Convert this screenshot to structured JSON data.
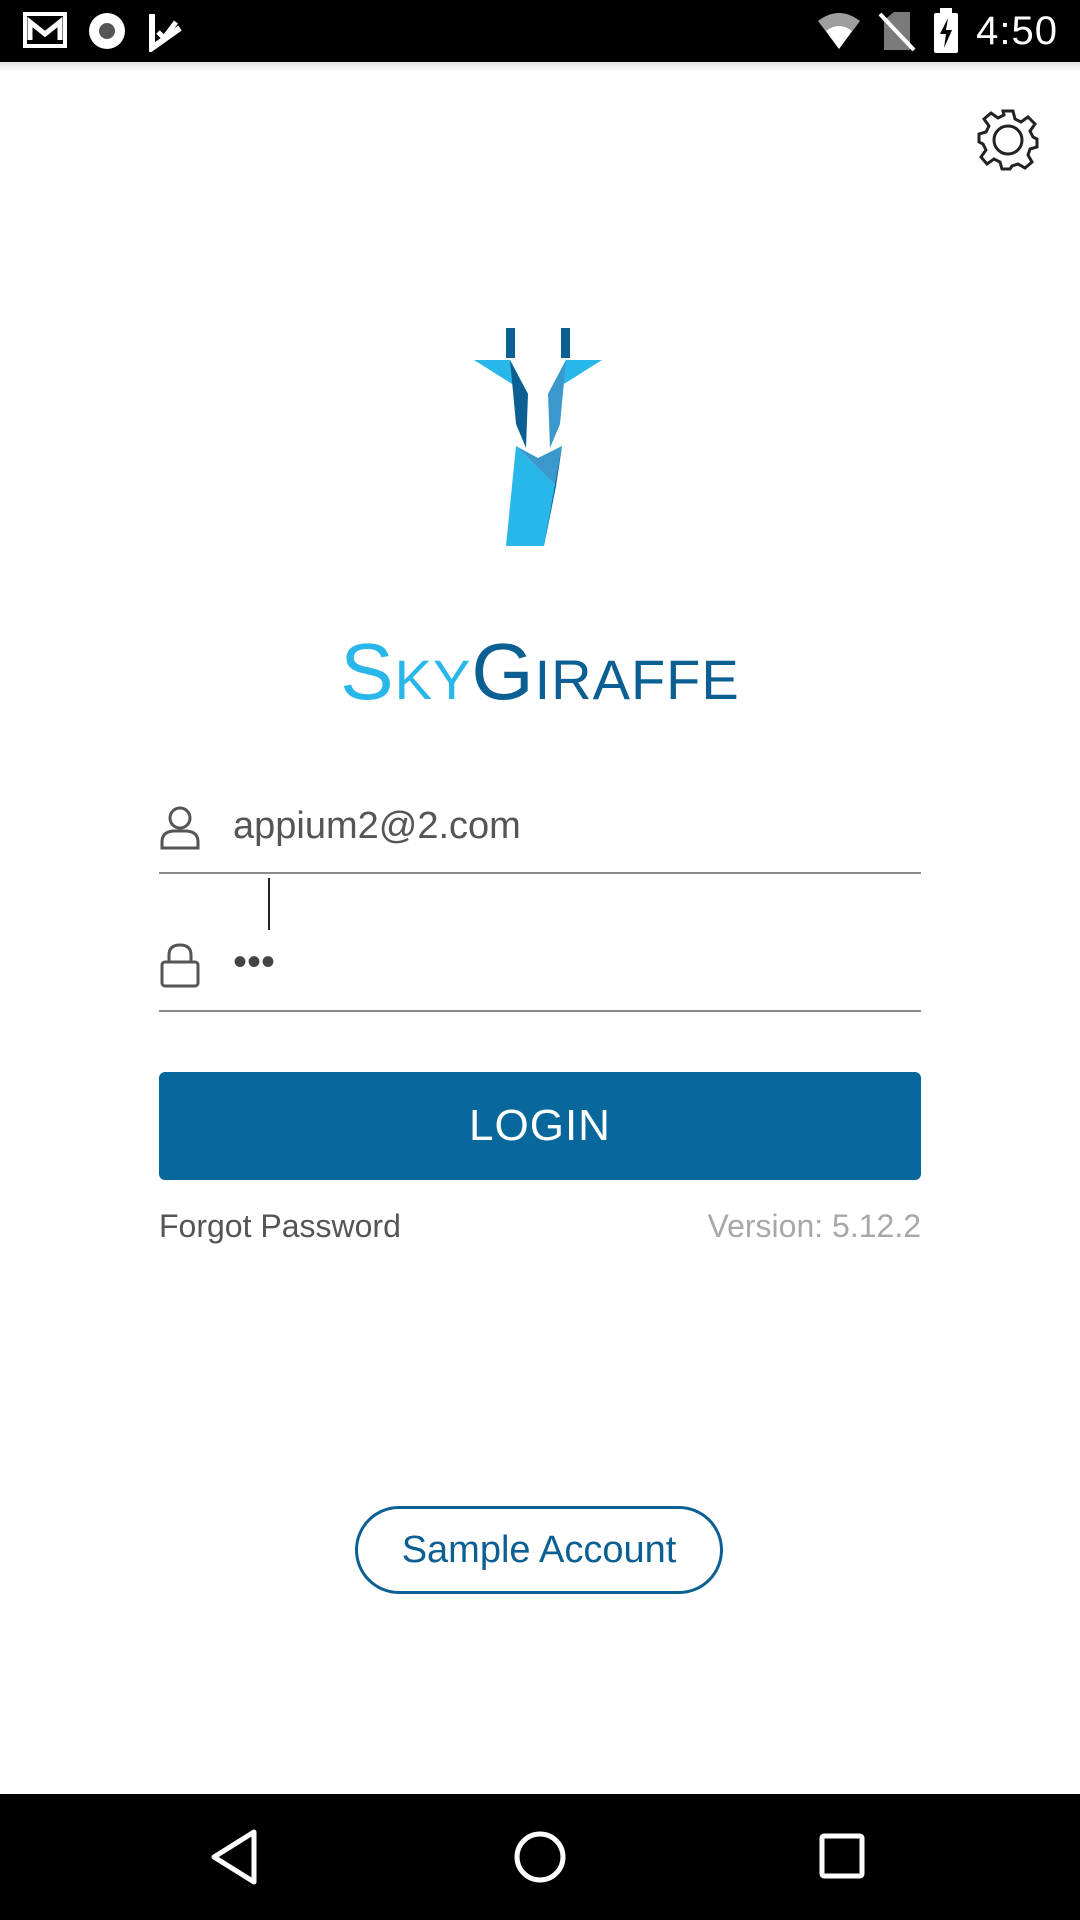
{
  "status_bar": {
    "time": "4:50",
    "icons": [
      "gmail-icon",
      "record-icon",
      "task-check-icon",
      "wifi-icon",
      "no-sim-icon",
      "battery-charging-icon"
    ]
  },
  "brand": {
    "name_sky": "Sky",
    "name_giraffe": "Giraffe",
    "colors": {
      "light_blue": "#29b6e8",
      "dark_blue": "#0b5f93",
      "button_blue": "#08679b"
    }
  },
  "login_form": {
    "email_value": "appium2@2.com",
    "password_mask": "•••",
    "login_label": "LOGIN",
    "forgot_password_label": "Forgot Password",
    "version_text": "Version: 5.12.2"
  },
  "sample_account_label": "Sample Account",
  "nav_bar": {
    "icons": [
      "back-icon",
      "home-icon",
      "recents-icon"
    ]
  }
}
